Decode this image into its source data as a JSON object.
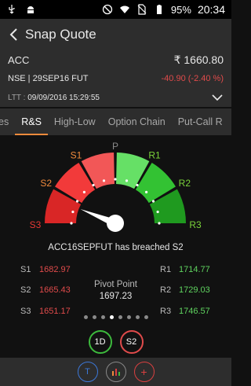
{
  "status_bar": {
    "battery_pct": "95%",
    "time": "20:34",
    "icons": [
      "usb-icon",
      "android-debug-icon",
      "dnd-icon",
      "wifi-icon",
      "sim-off-icon",
      "battery-icon"
    ]
  },
  "header": {
    "title": "Snap Quote"
  },
  "quote": {
    "symbol": "ACC",
    "ltp": "₹ 1660.80",
    "exchange": "NSE | 29SEP16 FUT",
    "change": "-40.90 (-2.40 %)",
    "ltt_label": "LTT :",
    "ltt_value": "09/09/2016 15:29:55"
  },
  "tabs": [
    {
      "label": "es"
    },
    {
      "label": "R&S",
      "active": true
    },
    {
      "label": "High-Low"
    },
    {
      "label": "Option Chain"
    },
    {
      "label": "Put-Call R"
    }
  ],
  "gauge": {
    "labels": {
      "s3": "S3",
      "s2": "S2",
      "s1": "S1",
      "p": "P",
      "r1": "R1",
      "r2": "R2",
      "r3": "R3"
    },
    "colors": {
      "s3": "#d92626",
      "s2": "#f23a3a",
      "s1": "#f25757",
      "r1": "#66e066",
      "r2": "#33c233",
      "r3": "#1f9a1f",
      "s_label_s1": "#f08a3c",
      "s_label_s2": "#f08a3c",
      "s_label_s3": "#e53935",
      "r_label": "#7ad33a",
      "p_label": "#8a8a8a"
    },
    "needle_level": "S2"
  },
  "breach_message": "ACC16SEPFUT has breached S2",
  "levels": {
    "support": [
      {
        "key": "S1",
        "value": "1682.97"
      },
      {
        "key": "S2",
        "value": "1665.43"
      },
      {
        "key": "S3",
        "value": "1651.17"
      }
    ],
    "resistance": [
      {
        "key": "R1",
        "value": "1714.77"
      },
      {
        "key": "R2",
        "value": "1729.03"
      },
      {
        "key": "R3",
        "value": "1746.57"
      }
    ],
    "pivot_label": "Pivot Point",
    "pivot_value": "1697.23"
  },
  "pager": {
    "count": 8,
    "active_index": 3
  },
  "chips": [
    {
      "label": "1D",
      "color": "green"
    },
    {
      "label": "S2",
      "color": "red"
    }
  ],
  "bottom_actions": [
    {
      "label": "T",
      "name": "trade-button"
    },
    {
      "label": "chart",
      "name": "chart-button"
    },
    {
      "label": "+",
      "name": "add-button"
    }
  ]
}
